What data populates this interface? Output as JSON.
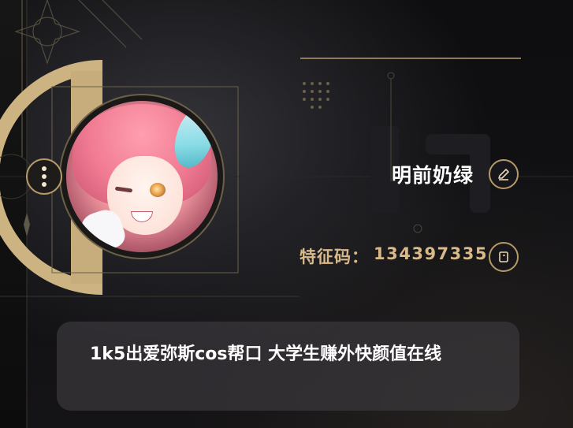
{
  "profile": {
    "name": "明前奶绿",
    "id_label": "特征码：",
    "id_value": "134397335",
    "bio": "1k5出爱弥斯cos帮口 大学生赚外快颜值在线"
  },
  "icons": {
    "menu": "more-vertical-icon",
    "edit": "pencil-icon",
    "copy": "copy-icon"
  },
  "colors": {
    "accent_gold": "#d8b98a",
    "frame_gold": "#b59a66",
    "card_bg": "#3a383c",
    "text_primary": "#ffffff"
  }
}
